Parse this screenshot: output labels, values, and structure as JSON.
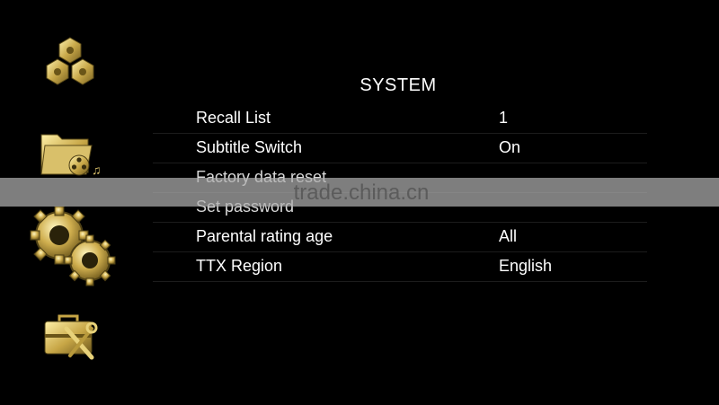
{
  "page": {
    "title": "SYSTEM"
  },
  "sidebar": {
    "icons": [
      {
        "name": "hexagon-cluster-icon"
      },
      {
        "name": "media-folder-icon"
      },
      {
        "name": "gears-icon"
      },
      {
        "name": "toolbox-icon"
      }
    ],
    "icon_color": "#d9c56a"
  },
  "menu": {
    "items": [
      {
        "label": "Recall List",
        "value": "1"
      },
      {
        "label": "Subtitle Switch",
        "value": "On"
      },
      {
        "label": "Factory data reset",
        "value": ""
      },
      {
        "label": "Set password",
        "value": ""
      },
      {
        "label": "Parental rating age",
        "value": "All"
      },
      {
        "label": "TTX Region",
        "value": "English"
      }
    ]
  },
  "watermark": {
    "text": "trade.china.cn"
  }
}
